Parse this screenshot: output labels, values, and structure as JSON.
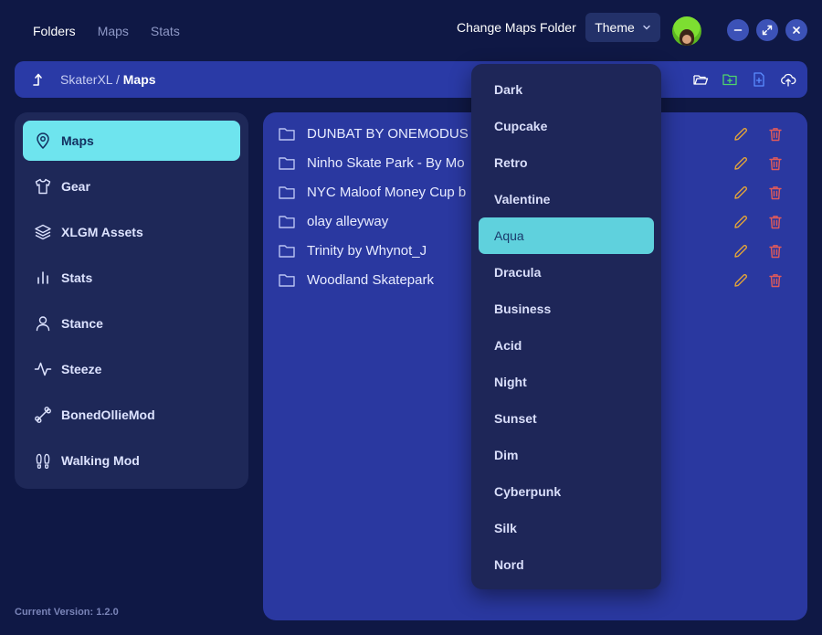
{
  "topnav": {
    "folders": "Folders",
    "maps": "Maps",
    "stats": "Stats"
  },
  "header": {
    "change_maps_folder": "Change Maps Folder",
    "theme_label": "Theme"
  },
  "breadcrumb": {
    "root": "SkaterXL",
    "separator": "/",
    "current": "Maps"
  },
  "sidebar": {
    "items": [
      {
        "label": "Maps",
        "icon": "map-pin-icon"
      },
      {
        "label": "Gear",
        "icon": "shirt-icon"
      },
      {
        "label": "XLGM Assets",
        "icon": "layers-icon"
      },
      {
        "label": "Stats",
        "icon": "bar-chart-icon"
      },
      {
        "label": "Stance",
        "icon": "user-icon"
      },
      {
        "label": "Steeze",
        "icon": "activity-icon"
      },
      {
        "label": "BonedOllieMod",
        "icon": "bone-icon"
      },
      {
        "label": "Walking Mod",
        "icon": "footprints-icon"
      }
    ]
  },
  "folders": [
    {
      "name": "DUNBAT BY ONEMODUS"
    },
    {
      "name": "Ninho Skate Park - By Mo"
    },
    {
      "name": "NYC Maloof Money Cup b"
    },
    {
      "name": "olay alleyway"
    },
    {
      "name": "Trinity by Whynot_J"
    },
    {
      "name": "Woodland Skatepark"
    }
  ],
  "theme_menu": {
    "selected": "Aqua",
    "options": [
      "Dark",
      "Cupcake",
      "Retro",
      "Valentine",
      "Aqua",
      "Dracula",
      "Business",
      "Acid",
      "Night",
      "Sunset",
      "Dim",
      "Cyberpunk",
      "Silk",
      "Nord"
    ]
  },
  "version": "Current Version: 1.2.0",
  "colors": {
    "background": "#0f1845",
    "accent_active": "#6ee4ee",
    "panel": "#2a38a0",
    "edit_icon": "#e0a23a",
    "delete_icon": "#e05a5a"
  }
}
